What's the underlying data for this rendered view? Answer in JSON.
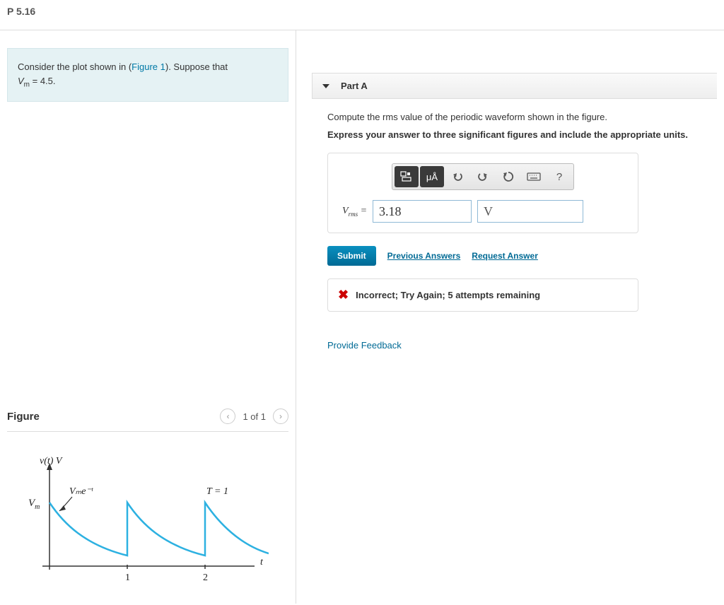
{
  "header": {
    "title": "P 5.16"
  },
  "problem": {
    "text_before": "Consider the plot shown in (",
    "figure_link": "Figure 1",
    "text_after": "). Suppose that ",
    "vm_symbol": "V",
    "vm_sub": "m",
    "vm_eq": " = 4.5."
  },
  "figure": {
    "title": "Figure",
    "nav_text": "1 of 1",
    "ylabel": "v(t) V",
    "vm_label": "V",
    "vm_sub": "m",
    "curve_label": "Vₘe⁻ᵗ",
    "period_label": "T = 1",
    "xlabel": "t",
    "tick1": "1",
    "tick2": "2"
  },
  "partA": {
    "title": "Part A",
    "instruction1": "Compute the rms value of the periodic waveform shown in the figure.",
    "instruction2": "Express your answer to three significant figures and include the appropriate units.",
    "toolbar": {
      "template": "template-icon",
      "units": "μÅ",
      "undo": "undo-icon",
      "redo": "redo-icon",
      "reset": "reset-icon",
      "keyboard": "keyboard-icon",
      "help": "?"
    },
    "vrms_label": "Vrms = ",
    "value_entered": "3.18",
    "unit_entered": "V",
    "submit_label": "Submit",
    "prev_answers": "Previous Answers",
    "request_answer": "Request Answer",
    "feedback_text": "Incorrect; Try Again; 5 attempts remaining"
  },
  "provide_feedback": "Provide Feedback",
  "chart_data": {
    "type": "line",
    "title": "",
    "xlabel": "t",
    "ylabel": "v(t) V",
    "ylim": [
      0,
      4.5
    ],
    "xlim": [
      0,
      3
    ],
    "period": 1,
    "Vm": 4.5,
    "formula": "Vm * exp(-t) repeated each period",
    "series": [
      {
        "name": "v(t)",
        "description": "Vm·e^(−t) on [0,1), periodic with T=1"
      }
    ],
    "xticks": [
      1,
      2
    ]
  }
}
